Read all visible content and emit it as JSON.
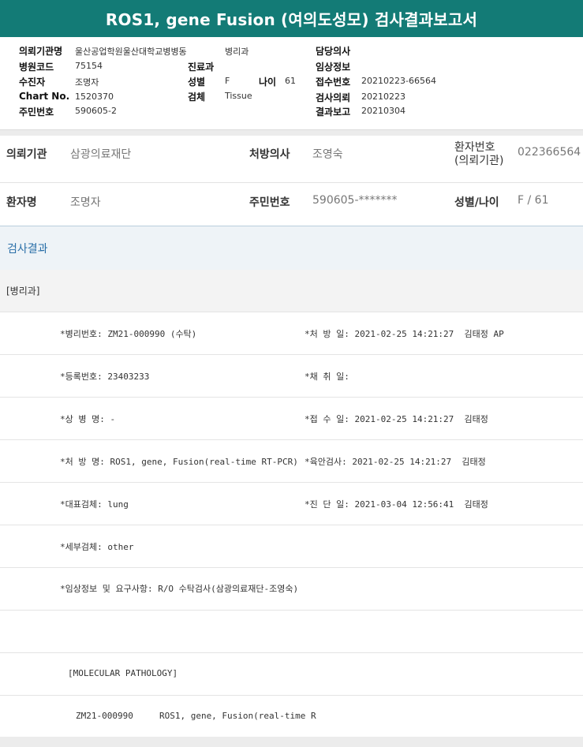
{
  "report_title": "ROS1, gene Fusion (여의도성모) 검사결과보고서",
  "header": {
    "fields": [
      {
        "label": "의뢰기관명",
        "value": "울산공업학원울산대학교병병동"
      },
      {
        "label": "병원코드",
        "value": "75154"
      },
      {
        "label": "수진자",
        "value": "조명자"
      },
      {
        "label": "Chart No.",
        "value": "1520370"
      },
      {
        "label": "주민번호",
        "value": "590605-2"
      },
      {
        "label": "진료과",
        "value": "병리과"
      },
      {
        "label": "성별",
        "value": "F"
      },
      {
        "label": "나이",
        "value": "61"
      },
      {
        "label": "검체",
        "value": "Tissue"
      },
      {
        "label": "담당의사",
        "value": ""
      },
      {
        "label": "임상정보",
        "value": ""
      },
      {
        "label": "접수번호",
        "value": "20210223-66564"
      },
      {
        "label": "검사의뢰",
        "value": "20210223"
      },
      {
        "label": "결과보고",
        "value": "20210304"
      }
    ]
  },
  "patient": {
    "institution_label": "의뢰기관",
    "institution_value": "삼광의료재단",
    "doctor_label": "처방의사",
    "doctor_value": "조영숙",
    "patient_no_label_1": "환자번호",
    "patient_no_label_2": "(의뢰기관)",
    "patient_no_value": "022366564",
    "name_label": "환자명",
    "name_value": "조명자",
    "rrn_label": "주민번호",
    "rrn_value": "590605-*******",
    "sexage_label": "성별/나이",
    "sexage_value": "F / 61"
  },
  "results": {
    "section_title": "검사결과",
    "department": "[병리과]",
    "rows": [
      {
        "left": "*병리번호: ZM21-000990 (수탁)",
        "right": "*처 방 일: 2021-02-25 14:21:27  김태정 AP"
      },
      {
        "left": "*등록번호: 23403233",
        "right": "*채 취 일:"
      },
      {
        "left": "*상 병 명: -",
        "right": "*접 수 일: 2021-02-25 14:21:27  김태정"
      },
      {
        "left": "*처 방 명: ROS1, gene, Fusion(real-time RT-PCR)",
        "right": "*육안검사: 2021-02-25 14:21:27  김태정"
      },
      {
        "left": "*대표검체: lung",
        "right": "*진 단 일: 2021-03-04 12:56:41  김태정"
      },
      {
        "left": "*세부검체: other",
        "right": ""
      },
      {
        "left": "*임상정보 및 요구사항: R/O 수탁검사(삼광의료재단-조영숙)",
        "right": ""
      },
      {
        "left": "",
        "right": ""
      }
    ],
    "molecular_header": "[MOLECULAR PATHOLOGY]",
    "molecular_line": "ZM21-000990     ROS1, gene, Fusion(real-time R"
  }
}
